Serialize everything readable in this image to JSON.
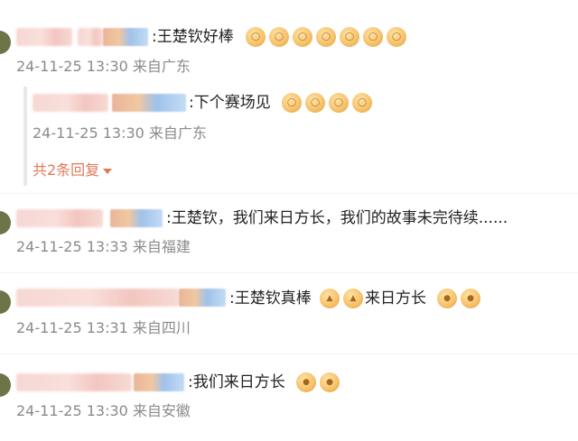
{
  "comments": [
    {
      "text": ":王楚钦好棒",
      "emojis": [
        "ok",
        "ok",
        "ok",
        "ok",
        "ok",
        "ok",
        "ok"
      ],
      "time": "24-11-25 13:30",
      "location": "来自广东"
    },
    {
      "text": ":王楚钦，我们来日方长，我们的故事未完待续......",
      "emojis": [],
      "time": "24-11-25 13:33",
      "location": "来自福建"
    },
    {
      "text": ":王楚钦真棒",
      "text_after": "来日方长",
      "emojis_mid": [
        "thumb",
        "thumb"
      ],
      "emojis": [
        "fist",
        "fist"
      ],
      "time": "24-11-25 13:31",
      "location": "来自四川"
    },
    {
      "text": ":我们来日方长",
      "emojis": [
        "fist",
        "fist"
      ],
      "time": "24-11-25 13:30",
      "location": "来自安徽"
    }
  ],
  "reply": {
    "text": ":下个赛场见",
    "emojis": [
      "ok",
      "ok",
      "ok",
      "ok"
    ],
    "time": "24-11-25 13:30",
    "location": "来自广东"
  },
  "expand_label": "共2条回复",
  "colors": {
    "meta": "#8a8a8a",
    "accent": "#e0795a",
    "text": "#222222"
  }
}
